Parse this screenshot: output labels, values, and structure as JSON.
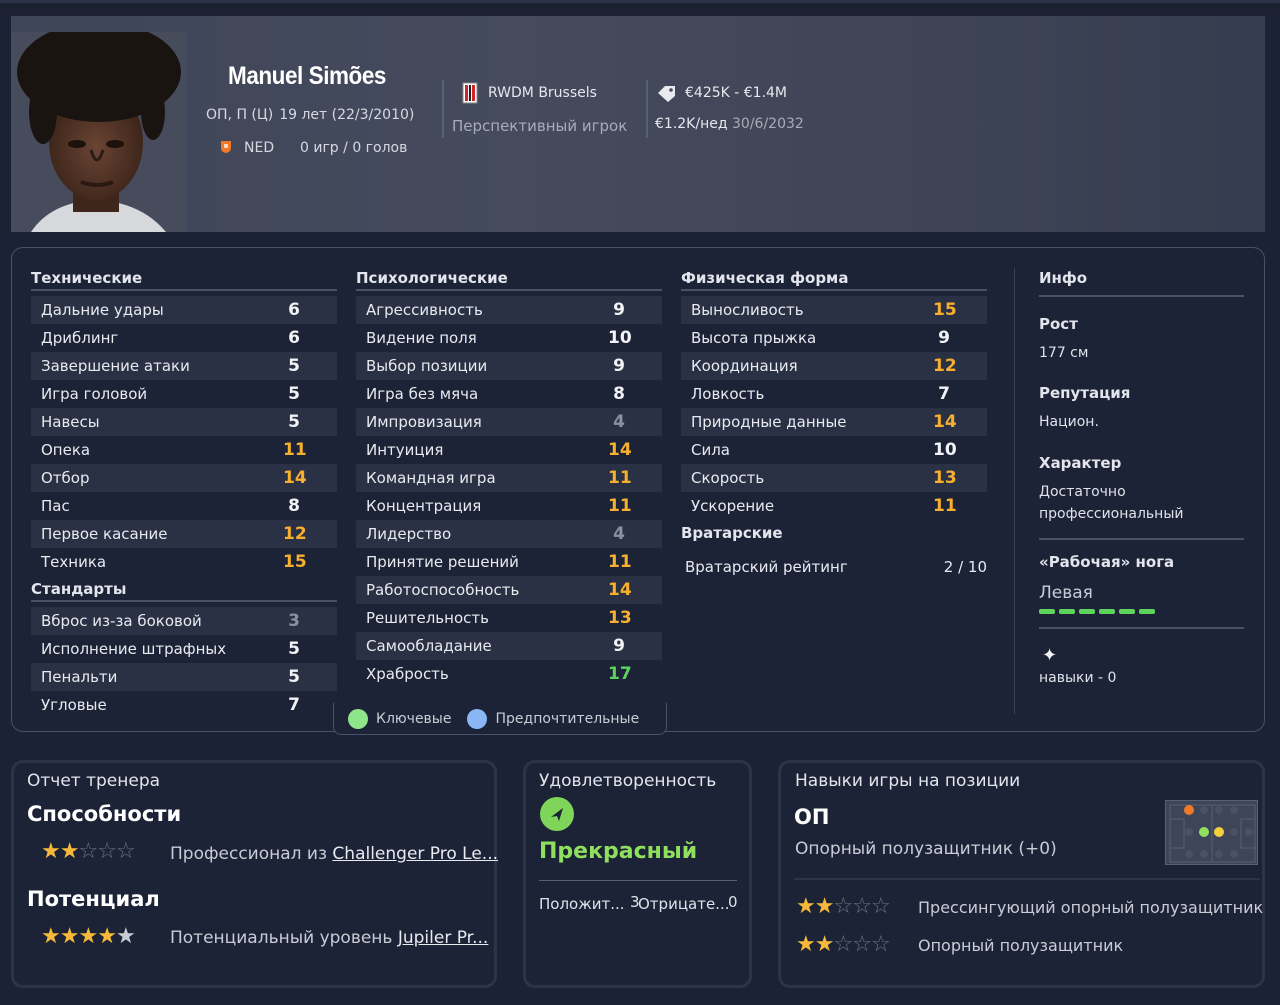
{
  "player": {
    "name": "Manuel Simões",
    "positions": "ОП, П (Ц)",
    "age": "19 лет (22/3/2010)",
    "nationality": "NED",
    "stats": "0 игр / 0 голов",
    "club": "RWDM Brussels",
    "status": "Перспективный игрок",
    "value": "€425K - €1.4M",
    "wage": "€1.2K/нед",
    "contract_end": "30/6/2032"
  },
  "sections": {
    "technical": "Технические",
    "set_pieces": "Стандарты",
    "mental": "Психологические",
    "physical": "Физическая форма",
    "goalkeeping": "Вратарские"
  },
  "technical": [
    {
      "label": "Дальние удары",
      "value": "6",
      "tone": "white"
    },
    {
      "label": "Дриблинг",
      "value": "6",
      "tone": "white"
    },
    {
      "label": "Завершение атаки",
      "value": "5",
      "tone": "white"
    },
    {
      "label": "Игра головой",
      "value": "5",
      "tone": "white"
    },
    {
      "label": "Навесы",
      "value": "5",
      "tone": "white"
    },
    {
      "label": "Опека",
      "value": "11",
      "tone": "orange"
    },
    {
      "label": "Отбор",
      "value": "14",
      "tone": "orange"
    },
    {
      "label": "Пас",
      "value": "8",
      "tone": "white"
    },
    {
      "label": "Первое касание",
      "value": "12",
      "tone": "orange"
    },
    {
      "label": "Техника",
      "value": "15",
      "tone": "orange"
    }
  ],
  "set_pieces": [
    {
      "label": "Вброс из-за боковой",
      "value": "3",
      "tone": "grey"
    },
    {
      "label": "Исполнение штрафных",
      "value": "5",
      "tone": "white"
    },
    {
      "label": "Пенальти",
      "value": "5",
      "tone": "white"
    },
    {
      "label": "Угловые",
      "value": "7",
      "tone": "white"
    }
  ],
  "mental": [
    {
      "label": "Агрессивность",
      "value": "9",
      "tone": "white"
    },
    {
      "label": "Видение поля",
      "value": "10",
      "tone": "white"
    },
    {
      "label": "Выбор позиции",
      "value": "9",
      "tone": "white"
    },
    {
      "label": "Игра без мяча",
      "value": "8",
      "tone": "white"
    },
    {
      "label": "Импровизация",
      "value": "4",
      "tone": "grey"
    },
    {
      "label": "Интуиция",
      "value": "14",
      "tone": "orange"
    },
    {
      "label": "Командная игра",
      "value": "11",
      "tone": "orange"
    },
    {
      "label": "Концентрация",
      "value": "11",
      "tone": "orange"
    },
    {
      "label": "Лидерство",
      "value": "4",
      "tone": "grey"
    },
    {
      "label": "Принятие решений",
      "value": "11",
      "tone": "orange"
    },
    {
      "label": "Работоспособность",
      "value": "14",
      "tone": "orange"
    },
    {
      "label": "Решительность",
      "value": "13",
      "tone": "orange"
    },
    {
      "label": "Самообладание",
      "value": "9",
      "tone": "white"
    },
    {
      "label": "Храбрость",
      "value": "17",
      "tone": "green"
    }
  ],
  "physical": [
    {
      "label": "Выносливость",
      "value": "15",
      "tone": "orange"
    },
    {
      "label": "Высота прыжка",
      "value": "9",
      "tone": "white"
    },
    {
      "label": "Координация",
      "value": "12",
      "tone": "orange"
    },
    {
      "label": "Ловкость",
      "value": "7",
      "tone": "white"
    },
    {
      "label": "Природные данные",
      "value": "14",
      "tone": "orange"
    },
    {
      "label": "Сила",
      "value": "10",
      "tone": "white"
    },
    {
      "label": "Скорость",
      "value": "13",
      "tone": "orange"
    },
    {
      "label": "Ускорение",
      "value": "11",
      "tone": "orange"
    }
  ],
  "goalkeeping": {
    "label": "Вратарский рейтинг",
    "value": "2 / 10"
  },
  "legend": {
    "key": "Ключевые",
    "preferred": "Предпочтительные"
  },
  "info": {
    "title": "Инфо",
    "height_label": "Рост",
    "height": "177 см",
    "reputation_label": "Репутация",
    "reputation": "Национ.",
    "character_label": "Характер",
    "character": "Достаточно профессиональный",
    "foot_label": "«Рабочая» нога",
    "foot": "Левая",
    "skills": "навыки - 0"
  },
  "coach_report": {
    "title": "Отчет тренера",
    "ability_label": "Способности",
    "ability_stars": 2,
    "ability_text": "Профессионал из",
    "ability_link": "Challenger Pro Le...",
    "potential_label": "Потенциал",
    "potential_stars": 4.5,
    "potential_text": "Потенциальный уровень",
    "potential_link": "Jupiler Pr..."
  },
  "satisfaction": {
    "title": "Удовлетворенность",
    "status": "Прекрасный",
    "positive_label": "Положит...",
    "positive_count": "3",
    "negative_label": "Отрицате...",
    "negative_count": "0"
  },
  "position_skills": {
    "title": "Навыки игры на позиции",
    "code": "ОП",
    "role": "Опорный полузащитник (+0)",
    "roles": [
      {
        "name": "Прессингующий опорный полузащитник",
        "stars": 2
      },
      {
        "name": "Опорный полузащитник",
        "stars": 2
      }
    ]
  },
  "colors": {
    "orange": "#f6b02e",
    "grey": "#8b90a0",
    "green": "#5fd45d",
    "white": "#f2f3f7"
  }
}
